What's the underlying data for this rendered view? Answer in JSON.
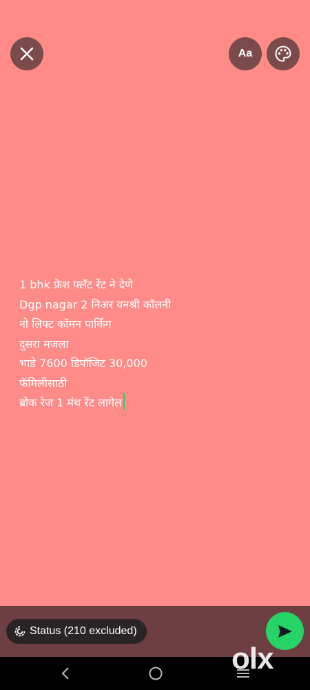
{
  "header": {
    "font_button_label": "Aa",
    "icons": {
      "close": "close-icon",
      "palette": "palette-icon"
    }
  },
  "colors": {
    "background": "#fe8b88",
    "bottom_bar": "#6e3f42",
    "send": "#25d366",
    "button": "#7b4a4a"
  },
  "status_text": {
    "lines": [
      "1 bhk फ्रेश  फ्लॅट रेंट ने देणे",
      "Dgp nagar 2 निअर वनश्री कॉलनी",
      "नो लिफ्ट कॉमन पार्किंग",
      "दुसरा मजला",
      "भाडे 7600 डिपॉजिट 30,000",
      "फॅमिलीसाठी",
      "ब्रोक रेज 1 मंथ रेंट लागेल"
    ]
  },
  "footer": {
    "audience_label": "Status (210 excluded)",
    "watermark": "olx"
  },
  "nav": {
    "icons": [
      "back-icon",
      "home-icon",
      "recents-icon"
    ]
  }
}
